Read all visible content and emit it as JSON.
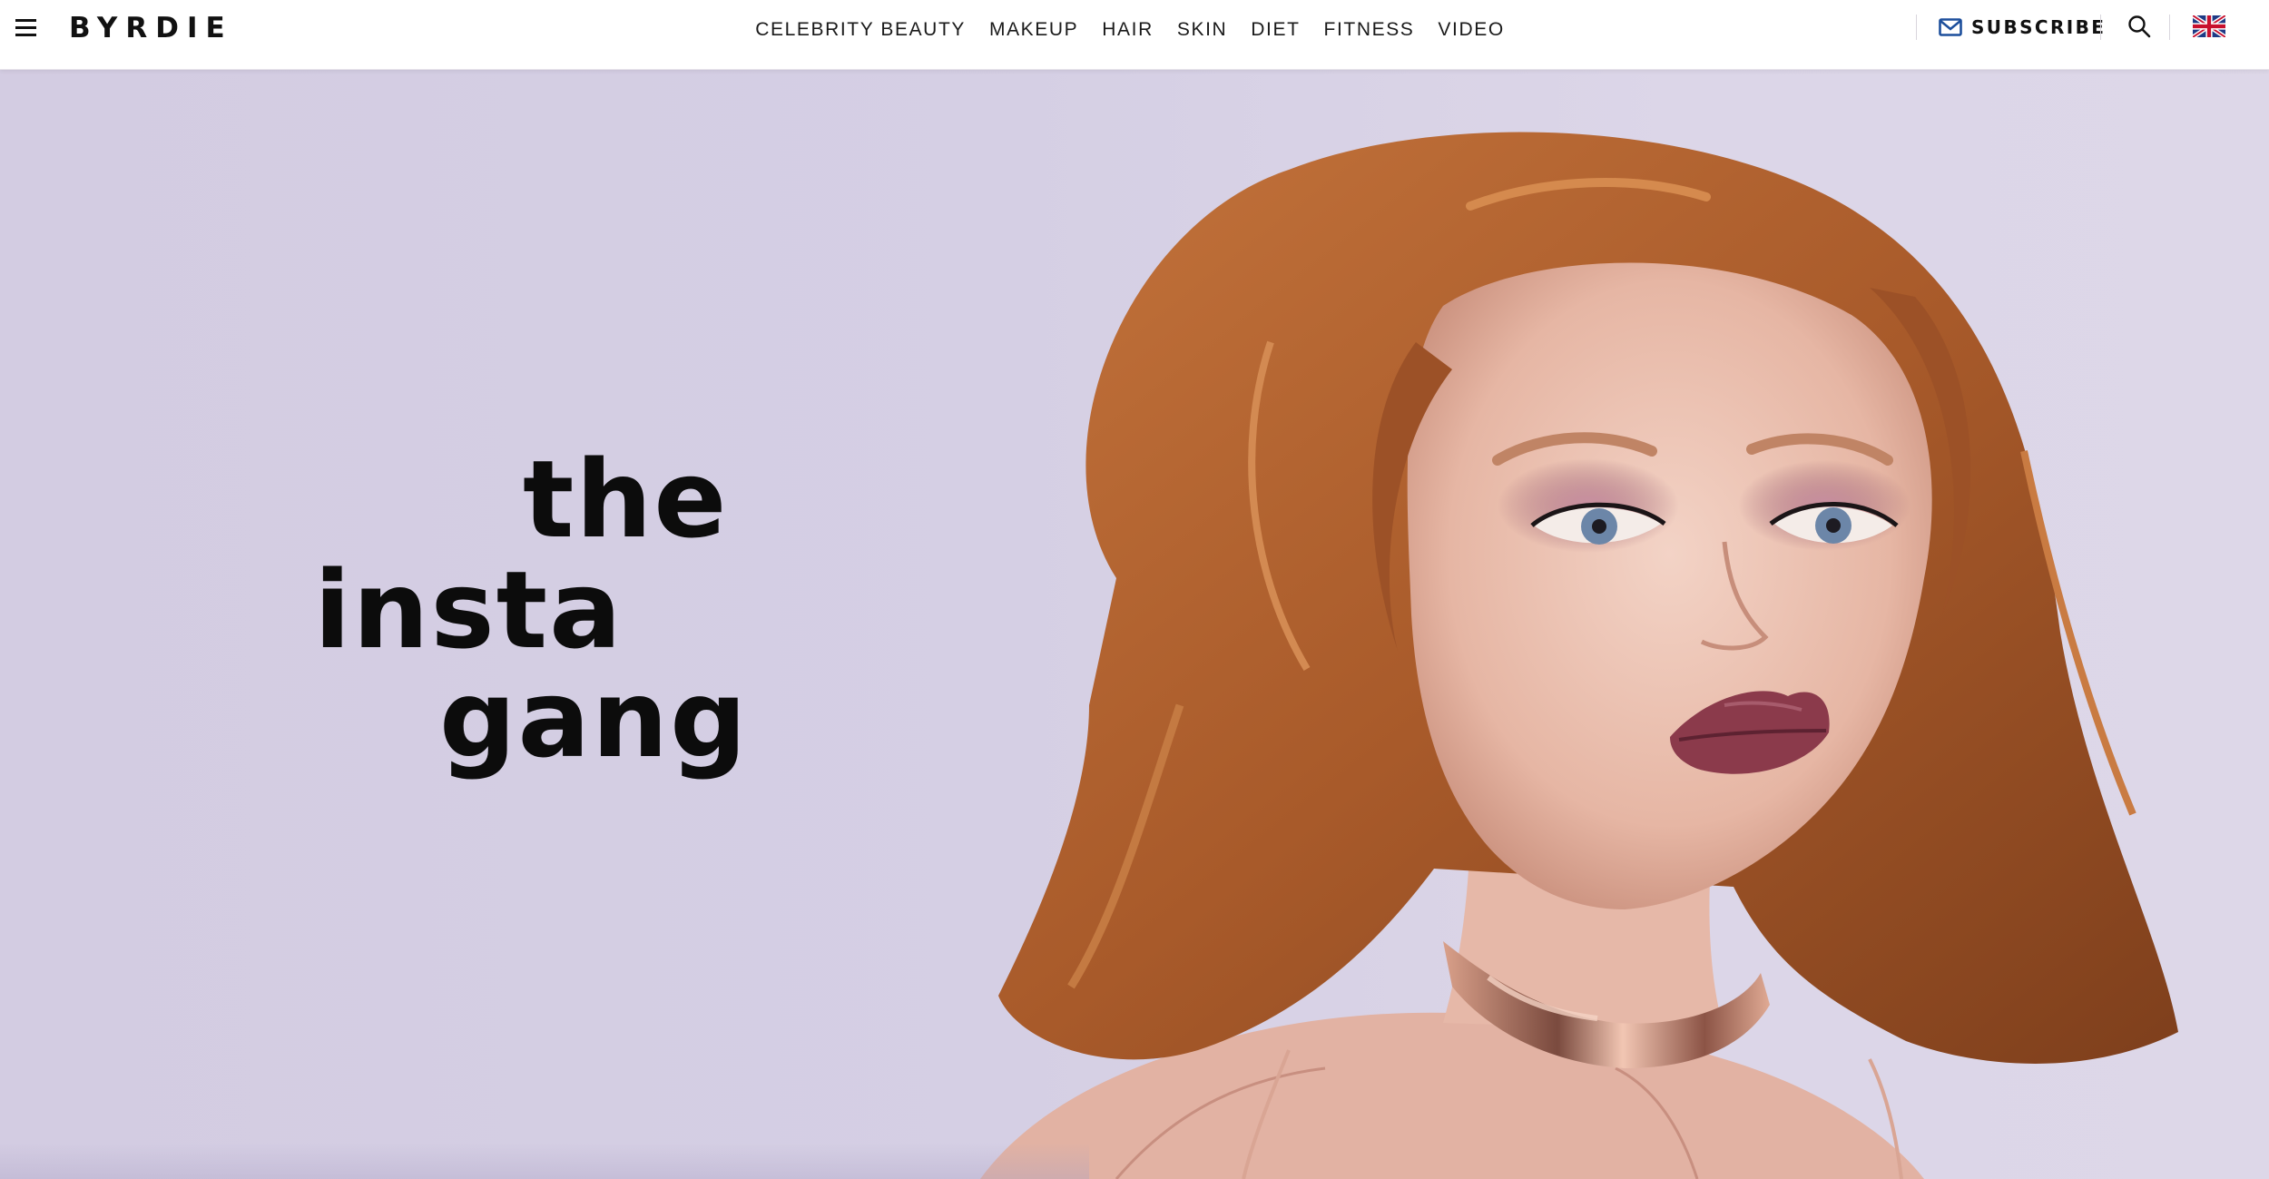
{
  "header": {
    "logo": "BYRDIE",
    "nav": [
      {
        "label": "CELEBRITY BEAUTY"
      },
      {
        "label": "MAKEUP"
      },
      {
        "label": "HAIR"
      },
      {
        "label": "SKIN"
      },
      {
        "label": "DIET"
      },
      {
        "label": "FITNESS"
      },
      {
        "label": "VIDEO"
      }
    ],
    "subscribe_label": "SUBSCRIBE",
    "icons": {
      "menu": "hamburger-menu-icon",
      "mail": "envelope-icon",
      "search": "search-icon",
      "region": "uk-flag-icon"
    }
  },
  "hero": {
    "headline": [
      "the",
      "insta",
      "gang"
    ],
    "background_color": "#d5cfe4",
    "image_subject": "portrait-photo"
  },
  "colors": {
    "text": "#111111",
    "mail_accent": "#1d4f9c",
    "hair": "#b5652f",
    "lip": "#8b3a4b"
  }
}
